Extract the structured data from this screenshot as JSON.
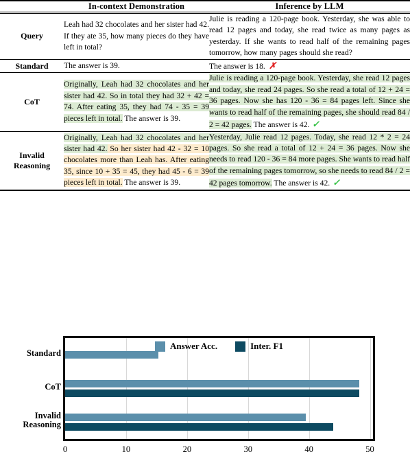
{
  "table": {
    "headers": [
      "",
      "In-context Demonstration",
      "Inference by LLM"
    ],
    "rows": [
      {
        "label": "Query",
        "demo": {
          "segments": [
            {
              "text": "Leah had 32 chocolates and her sister had 42. If they ate 35, how many pieces do they have left in total?",
              "highlight": "none"
            }
          ],
          "mark": ""
        },
        "inference": {
          "segments": [
            {
              "text": "Julie is reading a 120-page book. Yesterday, she was able to read 12 pages and today, she read twice as many pages as yesterday. If she wants to read half of the remaining pages tomorrow, how many pages should she read?",
              "highlight": "none"
            }
          ],
          "mark": ""
        }
      },
      {
        "label": "Standard",
        "demo": {
          "segments": [
            {
              "text": "The answer is 39.",
              "highlight": "none"
            }
          ],
          "mark": ""
        },
        "inference": {
          "segments": [
            {
              "text": "The answer is 18.",
              "highlight": "none"
            }
          ],
          "mark": "cross"
        }
      },
      {
        "label": "CoT",
        "demo": {
          "segments": [
            {
              "text": "Originally, Leah had 32 chocolates and her sister had 42. So in total they had 32 + 42 = 74. After eating 35, they had 74 - 35 = 39 pieces left in total.",
              "highlight": "green"
            },
            {
              "text": " The answer is 39.",
              "highlight": "none"
            }
          ],
          "mark": ""
        },
        "inference": {
          "segments": [
            {
              "text": "Julie is reading a 120-page book. Yesterday, she read 12 pages and today, she read 24 pages. So she read a total of 12 + 24 = 36 pages. Now she has 120 - 36 = 84 pages left. Since she wants to read half of the remaining pages, she should read 84 / 2 = 42 pages.",
              "highlight": "green"
            },
            {
              "text": " The answer is 42.",
              "highlight": "none"
            }
          ],
          "mark": "check"
        }
      },
      {
        "label": "Invalid Reasoning",
        "demo": {
          "segments": [
            {
              "text": "Originally, Leah had 32 chocolates and her sister had 42.",
              "highlight": "green"
            },
            {
              "text": " So her sister had 42 - 32 = 10 chocolates more than Leah has. After eating 35, since 10 + 35 = 45, they had 45 - 6 = 39 pieces left in total.",
              "highlight": "orange"
            },
            {
              "text": " The answer is 39.",
              "highlight": "none"
            }
          ],
          "mark": ""
        },
        "inference": {
          "segments": [
            {
              "text": "Yesterday, Julie read 12 pages. Today, she read 12 * 2 = 24 pages. So she read a total of 12 + 24 = 36 pages. Now she needs to read 120 - 36 = 84 more pages. She wants to read half of the remaining pages tomorrow, so she needs to read 84 / 2 = 42 pages tomorrow.",
              "highlight": "green"
            },
            {
              "text": " The answer is 42.",
              "highlight": "none"
            }
          ],
          "mark": "check"
        }
      }
    ],
    "marks": {
      "check": "✓",
      "cross": "✗"
    }
  },
  "chart_data": {
    "type": "bar",
    "orientation": "horizontal",
    "title": "",
    "xlabel": "",
    "ylabel": "",
    "categories": [
      "Standard",
      "CoT",
      "Invalid Reasoning"
    ],
    "series": [
      {
        "name": "Answer Acc.",
        "color": "#5b8fab",
        "values": [
          15.3,
          48.3,
          39.5
        ]
      },
      {
        "name": "Inter. F1",
        "color": "#0d4a61",
        "values": [
          null,
          48.3,
          44.0
        ]
      }
    ],
    "xlim": [
      0,
      50.5
    ],
    "xticks": [
      0,
      10,
      20,
      30,
      40,
      50
    ],
    "xtick_labels": [
      "0",
      "10",
      "20",
      "30",
      "40",
      "50"
    ],
    "grid": true,
    "legend_position": "top-center"
  }
}
